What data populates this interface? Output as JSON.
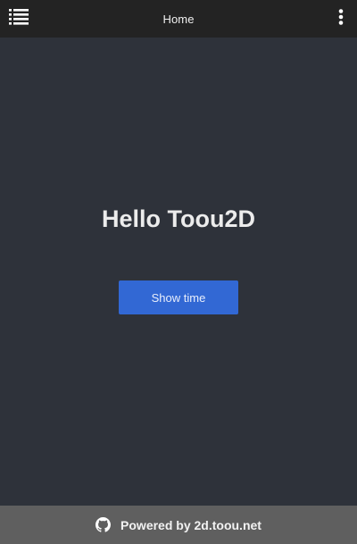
{
  "header": {
    "title": "Home",
    "menu_icon": "list-icon",
    "more_icon": "more-vertical-icon"
  },
  "main": {
    "headline": "Hello Toou2D",
    "button_label": "Show time"
  },
  "footer": {
    "icon": "github-icon",
    "text": "Powered by 2d.toou.net"
  },
  "colors": {
    "header_bg": "#232323",
    "page_bg": "#2e323a",
    "accent": "#3268d4",
    "footer_bg": "#5f5f5f"
  }
}
